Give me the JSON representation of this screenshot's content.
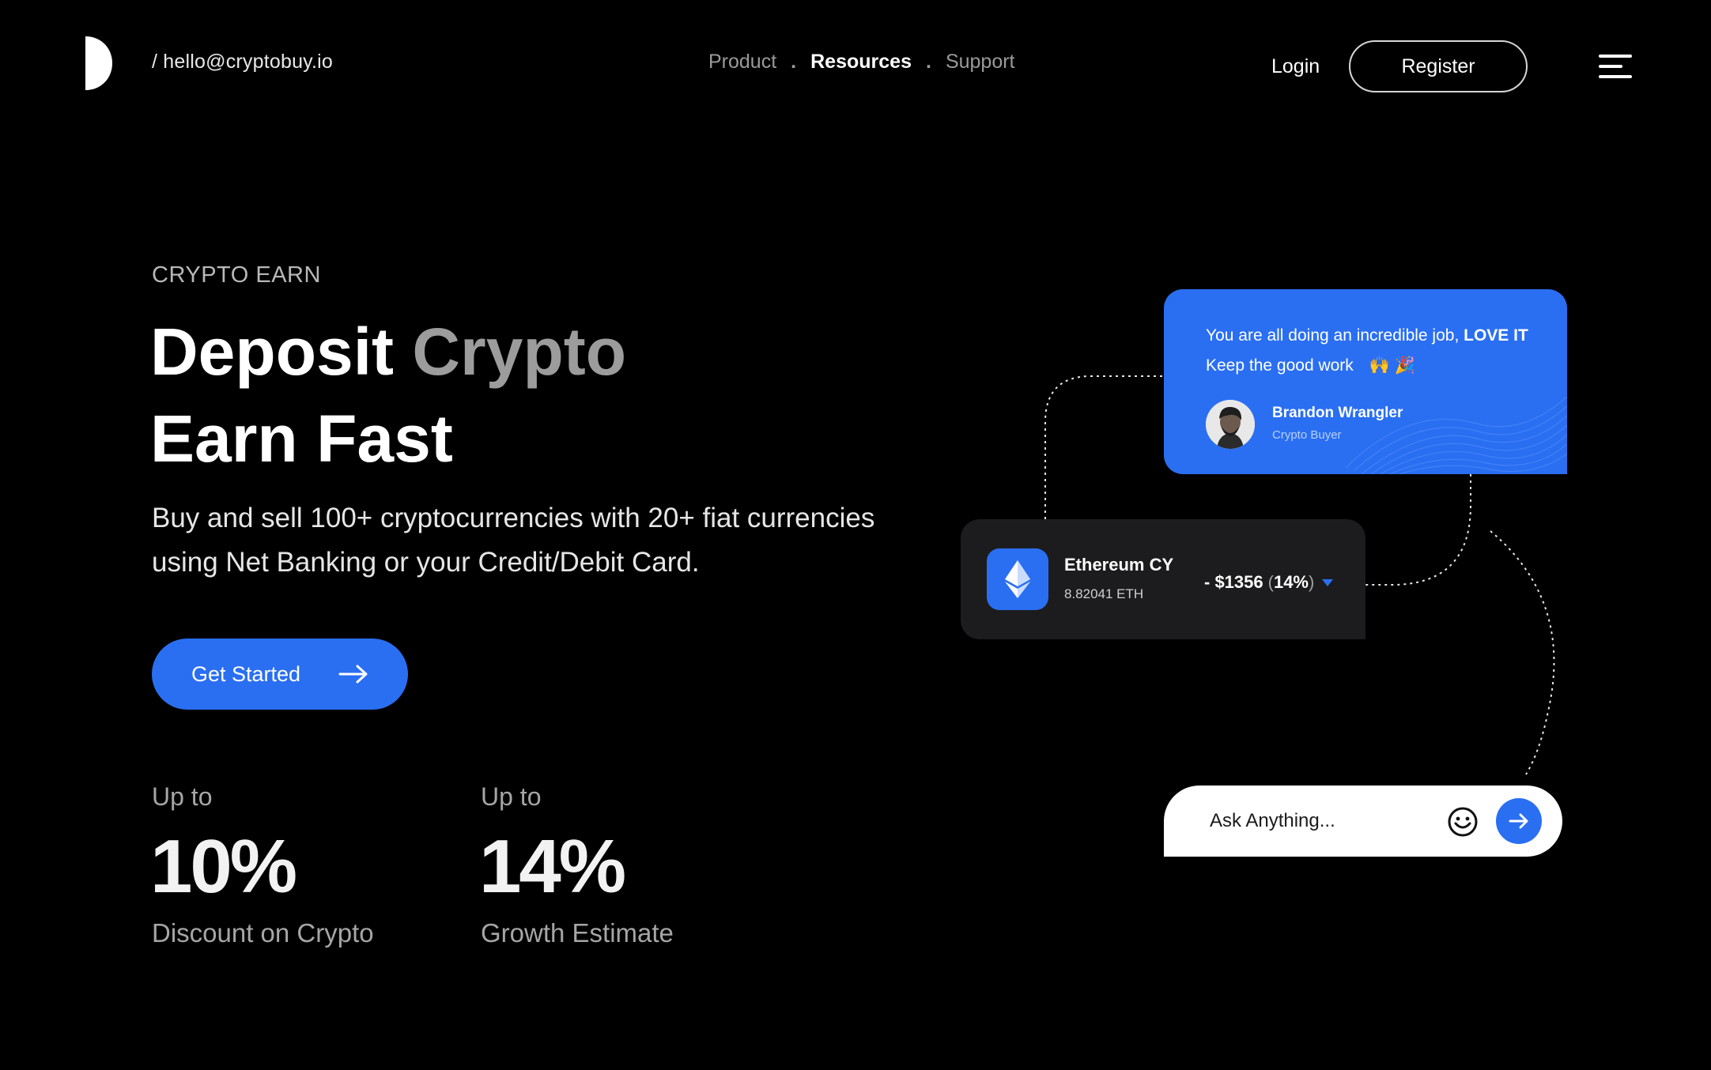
{
  "header": {
    "email": "/ hello@cryptobuy.io",
    "nav": [
      {
        "label": "Product",
        "active": false
      },
      {
        "label": "Resources",
        "active": true
      },
      {
        "label": "Support",
        "active": false
      }
    ],
    "nav_separator": ".",
    "login_label": "Login",
    "register_label": "Register",
    "logo_icon": "half-circle-logo",
    "menu_icon": "hamburger-menu-icon"
  },
  "hero": {
    "eyebrow": "CRYPTO EARN",
    "headline_line1_a": "Deposit",
    "headline_line1_b": "Crypto",
    "headline_line2": "Earn Fast",
    "subtext": "Buy and sell 100+ cryptocurrencies with 20+ fiat currencies using Net Banking or your Credit/Debit Card.",
    "cta_label": "Get Started",
    "cta_icon": "arrow-right-icon"
  },
  "stats": [
    {
      "prefix": "Up to",
      "value": "10%",
      "caption": "Discount on Crypto"
    },
    {
      "prefix": "Up to",
      "value": "14%",
      "caption": "Growth Estimate"
    }
  ],
  "review": {
    "message_a": "You are all doing an incredible job,",
    "message_bold": "LOVE IT",
    "message_b": "Keep the good work",
    "emojis": "🙌 🎉",
    "name": "Brandon Wrangler",
    "role": "Crypto Buyer"
  },
  "coin": {
    "name": "Ethereum CY",
    "amount": "8.82041 ETH",
    "price": "- $1356",
    "pct_open": "(",
    "pct": "14%",
    "pct_close": ")",
    "icon": "ethereum-icon"
  },
  "ask": {
    "placeholder": "Ask Anything...",
    "emoji_icon": "smiley-icon",
    "send_icon": "send-arrow-icon"
  },
  "colors": {
    "background": "#000000",
    "accent": "#2a6ff2",
    "card_dark": "#1c1c1e",
    "muted_text": "#9c9c9c"
  }
}
